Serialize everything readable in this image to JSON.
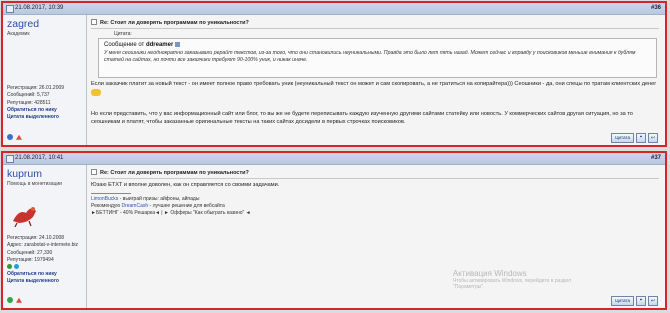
{
  "posts": [
    {
      "date": "21.08.2017, 10:39",
      "number": "#36",
      "author": {
        "name": "zagred",
        "title": "Академик",
        "reg": "Регистрация: 26.01.2009",
        "messages": "Сообщений: 5,737",
        "reputation": "Репутация: 428511",
        "link_contact": "Обратиться по нику",
        "link_quote": "Цитата выделенного"
      },
      "subject": "Re: Стоит ли доверять программам по уникальности?",
      "quote_caption": "Цитата:",
      "quote_header_prefix": "Сообщение от",
      "quote_author": "ddreamer",
      "quote_text": "У меня сеошники неоднократно заказывали рерайт текстов, из-за того, что они становились неуникальными. Правда это было лет пять назад. Может сейчас и вправду у поисковиков меньше внимания к дублям статей на сайтах, но почти все заказчики требуют 90-100% уник, и никак иначе.",
      "text_1": "Если заказчик платит за новый текст - он имеет полное право требовать уник (неуникальный текст он может и сам скопировать, а не тратиться на копирайтера))) Сеошники - да, они спецы по тратам клиентских денег",
      "text_2": "Но если представить, что у вас информационный сайт или блог, то вы же не будете переписывать каждую изученную другими сайтами статейку или новость. У коммерческих сайтов другая ситуация, но за то сеошникам и платят, чтобы заказанные оригинальные тексты на таких сайтах досидели в первых строчках поисковиков.",
      "quote_button": "Цитата"
    },
    {
      "date": "21.08.2017, 10:41",
      "number": "#37",
      "author": {
        "name": "kuprum",
        "title": "Помощь в монетизации",
        "reg": "Регистрация: 24.10.2008",
        "address": "Адрес: zarabotat-v-internete.biz",
        "messages": "Сообщений: 27,330",
        "reputation": "Репутация: 1979494",
        "link_contact": "Обратиться по нику",
        "link_quote": "Цитата выделенного"
      },
      "subject": "Re: Стоит ли доверять программам по уникальности?",
      "text_1": "Юзаю ETXT и вполне доволен, как он справляется со своими задачами.",
      "sig_1_link": "LimonBucks",
      "sig_1": " - выиграй призы: айфоны, айпады",
      "sig_2_prefix": "Рекомендую ",
      "sig_2_link": "DreamCash",
      "sig_2": " - лучшее решение для вебсайта",
      "sig_3": "►БЕТТИНГ - 40% Решарка◄ | ► Офферы \"Как обыграть казино\" ◄",
      "quote_button": "Цитата"
    }
  ],
  "watermark": {
    "line1": "Активация Windows",
    "line2": "Чтобы активировать Windows, перейдите в раздел",
    "line3": "\"Параметры\"."
  }
}
